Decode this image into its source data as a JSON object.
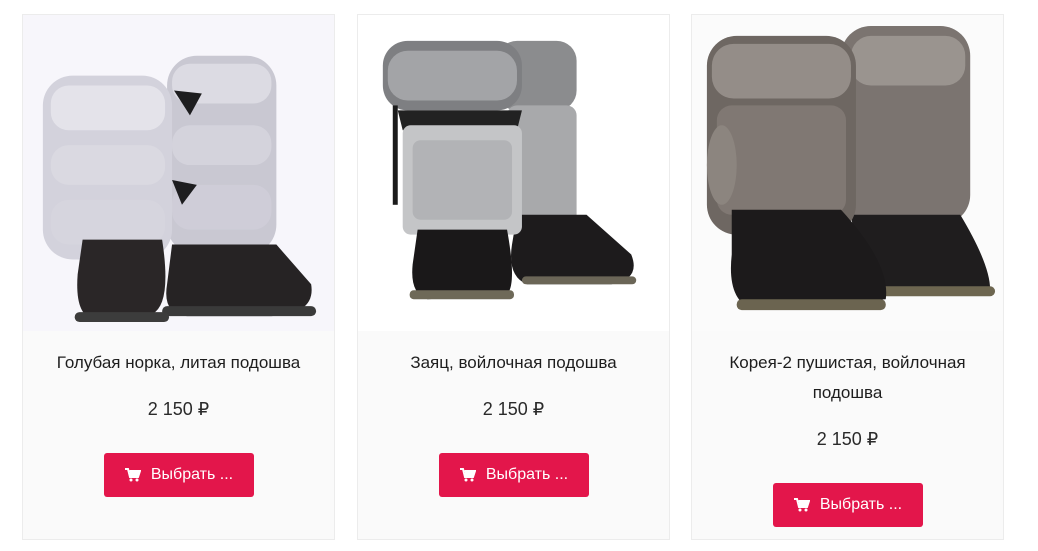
{
  "products": [
    {
      "name": "Голубая норка, литая подошва",
      "price": "2 150 ₽",
      "button_label": "Выбрать ...",
      "image_alt": "boots-blue-mink"
    },
    {
      "name": "Заяц, войлочная подошва",
      "price": "2 150 ₽",
      "button_label": "Выбрать ...",
      "image_alt": "boots-hare"
    },
    {
      "name": "Корея-2 пушистая, войлочная подошва",
      "price": "2 150 ₽",
      "button_label": "Выбрать ...",
      "image_alt": "boots-korea-2"
    }
  ],
  "theme": {
    "accent": "#e3164b",
    "card_background": "#fafafa",
    "icon": "cart-icon"
  }
}
